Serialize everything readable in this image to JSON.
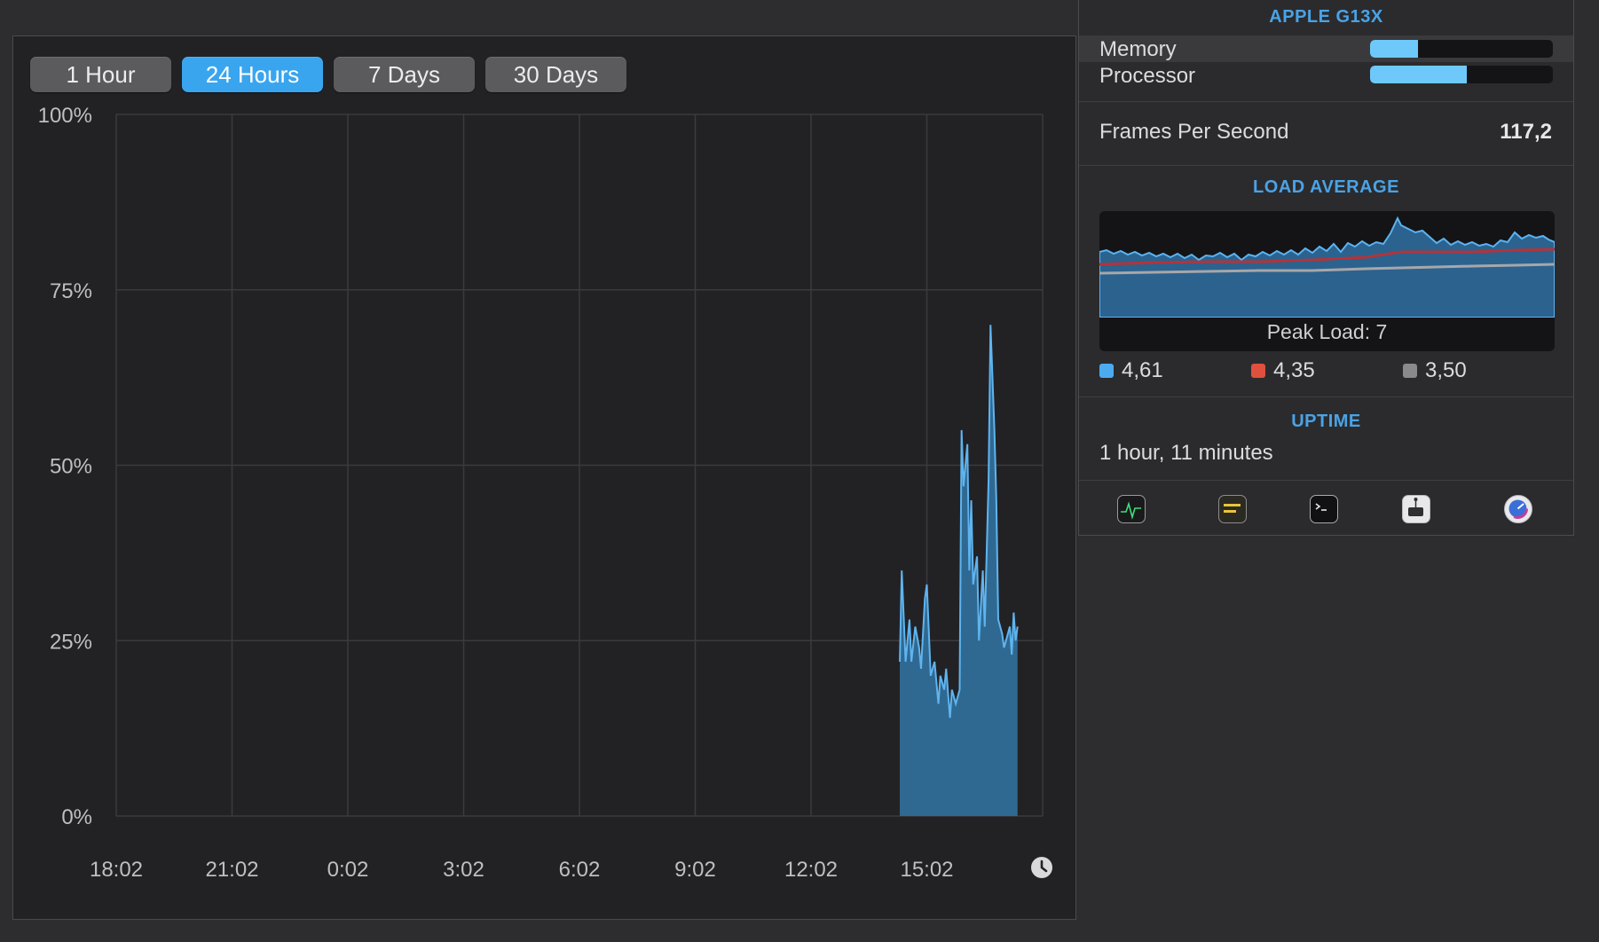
{
  "history": {
    "range_buttons": [
      {
        "label": "1 Hour",
        "active": false
      },
      {
        "label": "24 Hours",
        "active": true
      },
      {
        "label": "7 Days",
        "active": false
      },
      {
        "label": "30 Days",
        "active": false
      }
    ]
  },
  "chart_data": {
    "type": "area",
    "y_ticks": [
      "100%",
      "75%",
      "50%",
      "25%",
      "0%"
    ],
    "x_ticks": [
      "18:02",
      "21:02",
      "0:02",
      "3:02",
      "6:02",
      "9:02",
      "12:02",
      "15:02"
    ],
    "ylim": [
      0,
      100
    ],
    "grid": true,
    "color": "#5fb4ef",
    "fill": "#2f6992",
    "series": [
      {
        "x_hours": [
          20.3,
          20.35,
          20.45,
          20.55,
          20.6,
          20.7,
          20.8,
          20.85,
          20.95,
          21.0,
          21.1,
          21.2,
          21.3,
          21.35,
          21.45,
          21.5,
          21.6,
          21.65,
          21.75,
          21.85,
          21.9,
          21.95,
          22.05,
          22.1,
          22.15,
          22.2,
          22.3,
          22.35,
          22.45,
          22.5,
          22.6,
          22.65,
          22.75,
          22.8,
          22.85,
          22.95,
          23.0,
          23.1,
          23.15,
          23.2,
          23.25,
          23.3,
          23.35,
          23.4,
          23.45,
          23.5,
          23.6,
          23.65,
          23.7,
          23.8,
          23.85,
          23.9,
          24.0
        ],
        "values": [
          22,
          35,
          22,
          28,
          22,
          27,
          24,
          21,
          31,
          33,
          20,
          22,
          16,
          20,
          18,
          21,
          14,
          18,
          16,
          18,
          55,
          47,
          53,
          35,
          45,
          33,
          37,
          25,
          35,
          27,
          48,
          70,
          55,
          45,
          28,
          26,
          24,
          26,
          27,
          23,
          29,
          25,
          27
        ]
      }
    ]
  },
  "panel": {
    "gpu_title": "APPLE G13X",
    "memory": {
      "label": "Memory",
      "fill": 0.26
    },
    "processor": {
      "label": "Processor",
      "fill": 0.53
    },
    "fps": {
      "label": "Frames Per Second",
      "value": "117,2"
    },
    "load_title": "LOAD AVERAGE",
    "peak_load": "Peak Load: 7",
    "load_legend": [
      {
        "value": "4,61",
        "color": "#4cabf0"
      },
      {
        "value": "4,35",
        "color": "#e0503f"
      },
      {
        "value": "3,50",
        "color": "#8a8a8d"
      }
    ],
    "uptime_title": "UPTIME",
    "uptime_value": "1 hour, 11 minutes",
    "app_icons": [
      "activity-monitor-icon",
      "console-icon",
      "terminal-icon",
      "system-information-icon",
      "istat-icon"
    ]
  }
}
